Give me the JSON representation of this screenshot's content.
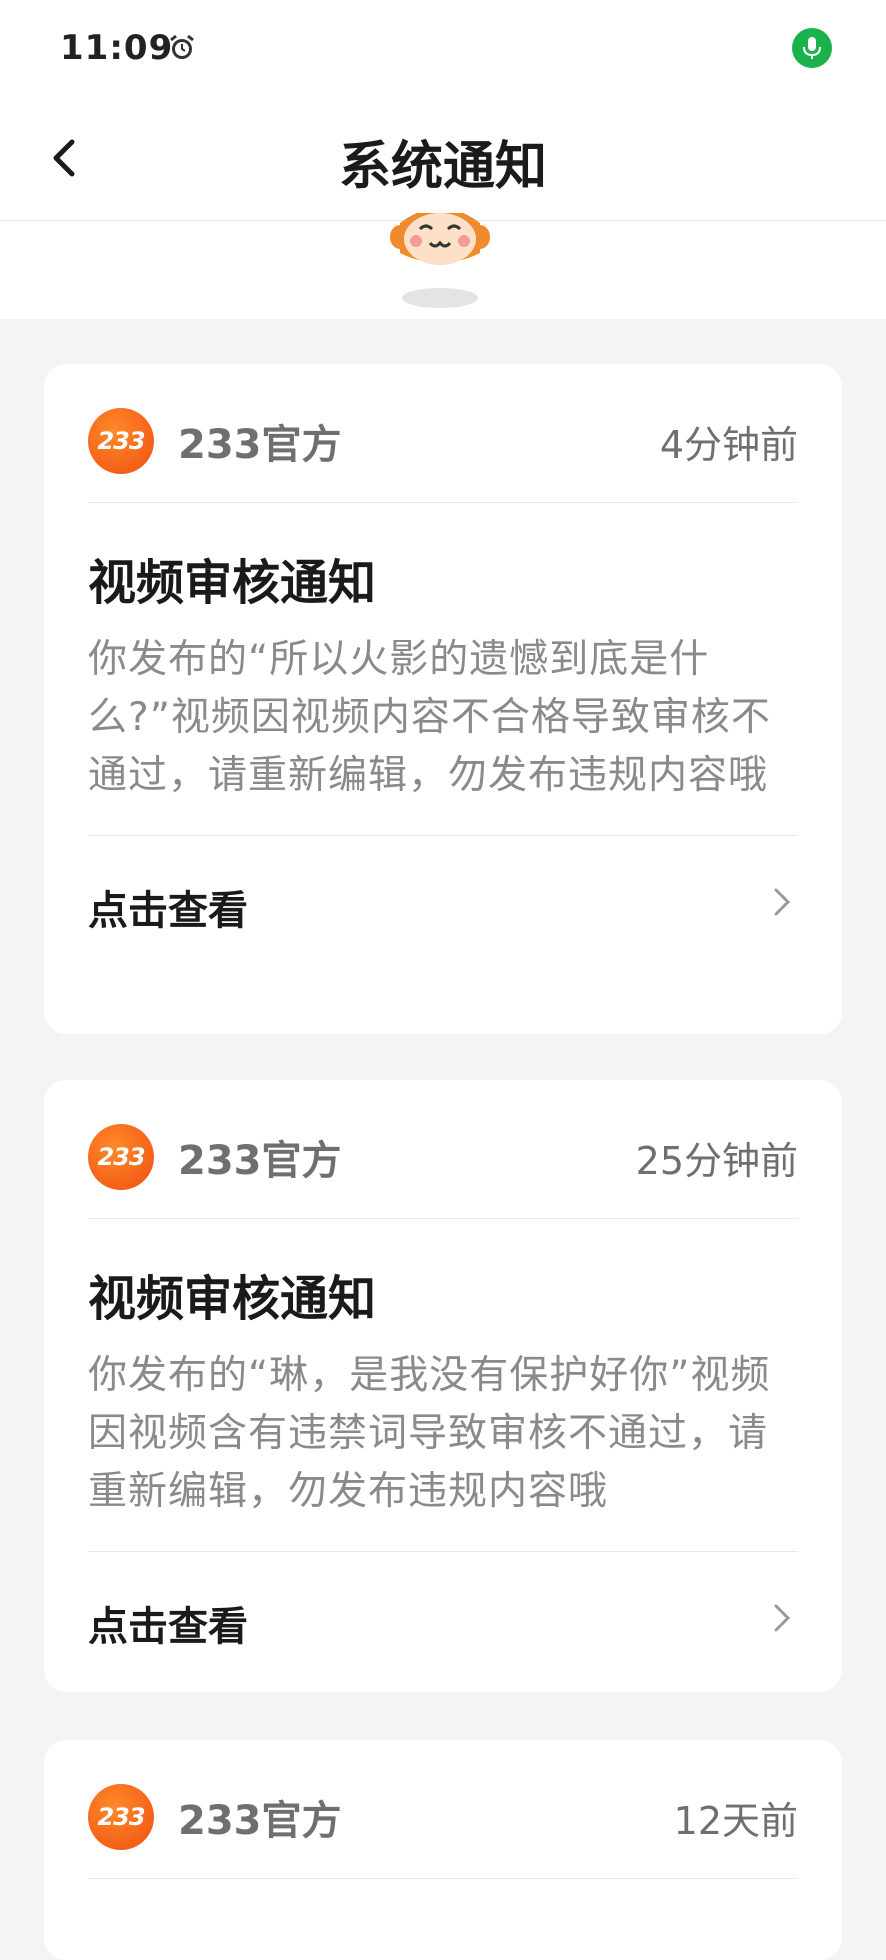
{
  "status_bar": {
    "time": "11:09",
    "alarm_icon": "alarm-clock-icon",
    "mic_icon": "microphone-icon",
    "mic_color": "#19b24b"
  },
  "header": {
    "title": "系统通知",
    "back_icon": "chevron-left-icon"
  },
  "accent_color": "#f04e10",
  "notifications": [
    {
      "logo_text": "233",
      "source": "233官方",
      "time_ago": "4分钟前",
      "title": "视频审核通知",
      "body": "你发布的“所以火影的遗憾到底是什么?”视频因视频内容不合格导致审核不通过，请重新编辑，勿发布违规内容哦",
      "action": "点击查看"
    },
    {
      "logo_text": "233",
      "source": "233官方",
      "time_ago": "25分钟前",
      "title": "视频审核通知",
      "body": "你发布的“琳，是我没有保护好你”视频因视频含有违禁词导致审核不通过，请重新编辑，勿发布违规内容哦",
      "action": "点击查看"
    },
    {
      "logo_text": "233",
      "source": "233官方",
      "time_ago": "12天前"
    }
  ]
}
